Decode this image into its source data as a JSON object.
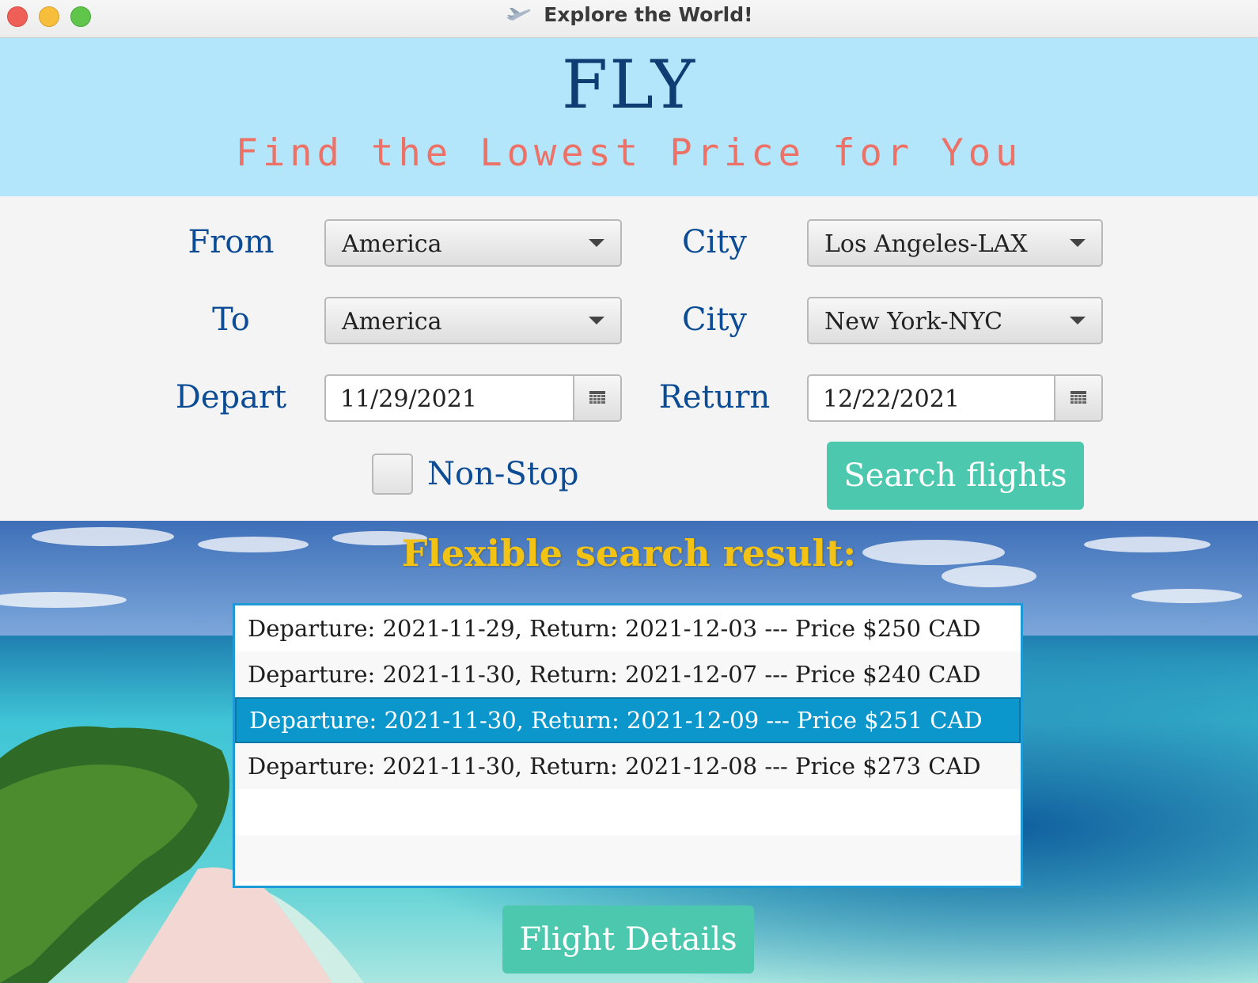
{
  "window": {
    "title": "Explore the World!",
    "icon": "airplane-icon"
  },
  "header": {
    "title": "FLY",
    "subtitle": "Find the Lowest Price for You"
  },
  "form": {
    "from_label": "From",
    "from_country": "America",
    "from_city_label": "City",
    "from_city": "Los Angeles-LAX",
    "to_label": "To",
    "to_country": "America",
    "to_city_label": "City",
    "to_city": "New York-NYC",
    "depart_label": "Depart",
    "depart_date": "11/29/2021",
    "return_label": "Return",
    "return_date": "12/22/2021",
    "nonstop_label": "Non-Stop",
    "nonstop_checked": false,
    "search_button": "Search flights"
  },
  "results": {
    "title": "Flexible search result:",
    "items": [
      "Departure: 2021-11-29, Return: 2021-12-03 --- Price $250 CAD",
      "Departure: 2021-11-30, Return: 2021-12-07 --- Price $240 CAD",
      "Departure: 2021-11-30, Return: 2021-12-09 --- Price $251 CAD",
      "Departure: 2021-11-30, Return: 2021-12-08 --- Price $273 CAD"
    ],
    "selected_index": 2,
    "details_button": "Flight Details"
  },
  "colors": {
    "header_bg": "#b3e5fb",
    "title_color": "#0e3d73",
    "subtitle_color": "#ec7268",
    "label_color": "#0c4c95",
    "button_bg": "#4bc8ad",
    "result_title_color": "#f2c214",
    "selected_row_bg": "#0b96cc"
  }
}
